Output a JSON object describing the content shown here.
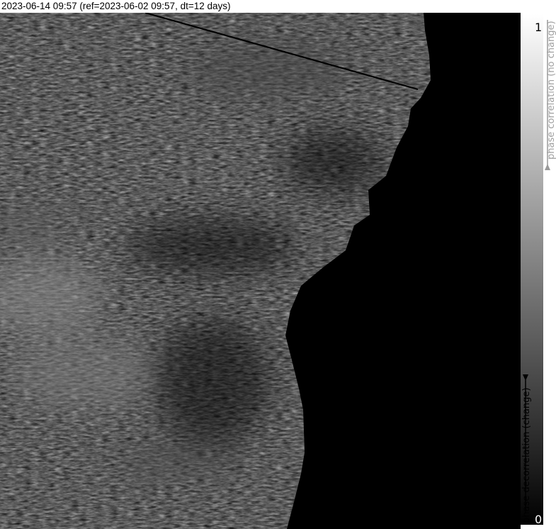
{
  "header": {
    "title": "2023-06-14 09:57 (ref=2023-06-02 09:57, dt=12 days)"
  },
  "image": {
    "description_icon": "sar-coherence-image"
  },
  "colorbar": {
    "max_label": "1",
    "min_label": "0",
    "upper_caption": "phase correlation (no change)",
    "lower_caption": "phase decorrelation (change)",
    "gradient_top_color": "#ffffff",
    "gradient_bottom_color": "#000000"
  }
}
